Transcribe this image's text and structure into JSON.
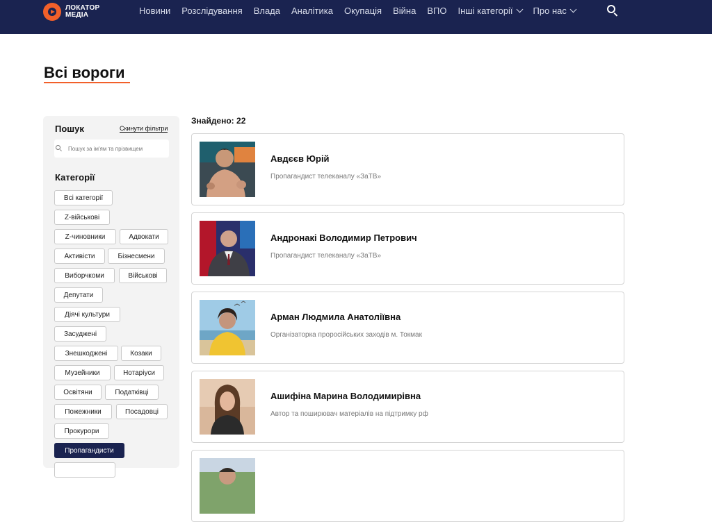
{
  "header": {
    "logo_line1": "ЛОКАТОР",
    "logo_line2": "МЕДІА",
    "nav": [
      {
        "label": "Новини"
      },
      {
        "label": "Розслідування"
      },
      {
        "label": "Влада"
      },
      {
        "label": "Аналітика"
      },
      {
        "label": "Окупація"
      },
      {
        "label": "Війна"
      },
      {
        "label": "ВПО"
      },
      {
        "label": "Інші категорії",
        "dropdown": true
      },
      {
        "label": "Про нас",
        "dropdown": true
      }
    ],
    "search_icon": "search-icon"
  },
  "page": {
    "title": "Всі вороги"
  },
  "sidebar": {
    "search_title": "Пошук",
    "reset_label": "Скинути фільтри",
    "search_placeholder": "Пошук за ім'ям та прізвищем",
    "categories_title": "Категорії",
    "categories": [
      {
        "label": "Всі категорії",
        "active": false
      },
      {
        "label": "Z-військові",
        "active": false
      },
      {
        "label": "Z-чиновники",
        "active": false
      },
      {
        "label": "Адвокати",
        "active": false
      },
      {
        "label": "Активісти",
        "active": false
      },
      {
        "label": "Бізнесмени",
        "active": false
      },
      {
        "label": "Виборчкоми",
        "active": false
      },
      {
        "label": "Військові",
        "active": false
      },
      {
        "label": "Депутати",
        "active": false
      },
      {
        "label": "Діячі культури",
        "active": false
      },
      {
        "label": "Засуджені",
        "active": false
      },
      {
        "label": "Знешкоджені",
        "active": false
      },
      {
        "label": "Козаки",
        "active": false
      },
      {
        "label": "Музейники",
        "active": false
      },
      {
        "label": "Нотаріуси",
        "active": false
      },
      {
        "label": "Освітяни",
        "active": false
      },
      {
        "label": "Податківці",
        "active": false
      },
      {
        "label": "Пожежники",
        "active": false
      },
      {
        "label": "Посадовці",
        "active": false
      },
      {
        "label": "Прокурори",
        "active": false
      },
      {
        "label": "Пропагандисти",
        "active": true
      }
    ]
  },
  "results": {
    "found_label": "Знайдено: 22",
    "items": [
      {
        "name": "Авдєєв Юрій",
        "role": "Пропагандист телеканалу «ЗаТВ»"
      },
      {
        "name": "Андронакі Володимир Петрович",
        "role": "Пропагандист телеканалу «ЗаТВ»"
      },
      {
        "name": "Арман Людмила Анатоліївна",
        "role": "Організаторка проросійських заходів м. Токмак"
      },
      {
        "name": "Ашифіна Марина Володимирівна",
        "role": "Автор та поширювач матеріалів на підтримку рф"
      }
    ]
  },
  "colors": {
    "header_bg": "#1a2350",
    "accent": "#f2602a",
    "active_category": "#1a2350"
  }
}
